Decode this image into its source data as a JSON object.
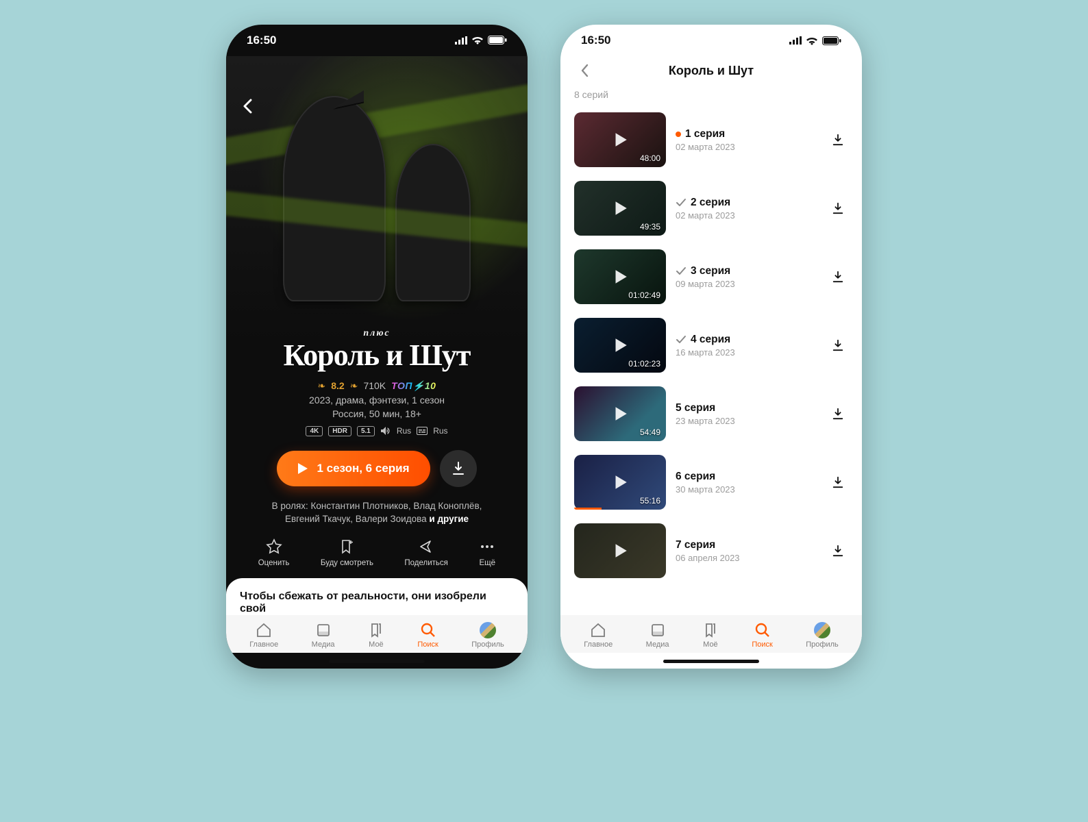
{
  "status": {
    "time": "16:50"
  },
  "dark": {
    "brand": "плюс",
    "title": "Король и Шут",
    "rating": "8.2",
    "rating_count": "710K",
    "top": "ТОП⚡10",
    "meta1": "2023, драма, фэнтези, 1 сезон",
    "meta2": "Россия, 50 мин, 18+",
    "tech": {
      "k4": "4K",
      "hdr": "HDR",
      "audio51": "5.1",
      "audio_lang": "Rus",
      "sub_lang": "Rus"
    },
    "play_label": "1 сезон, 6 серия",
    "cast_prefix": "В ролях: ",
    "cast": "Константин Плотников, Влад Коноплёв, Евгений Ткачук, Валери Зоидова",
    "cast_more": "и другие",
    "actions": {
      "rate": "Оценить",
      "watch": "Буду смотреть",
      "share": "Поделиться",
      "more": "Ещё"
    },
    "blurb": "Чтобы сбежать от реальности, они изобрели свой"
  },
  "light": {
    "title": "Король и Шут",
    "count": "8 серий",
    "episodes": [
      {
        "title": "1 серия",
        "date": "02 марта 2023",
        "dur": "48:00",
        "status": "current",
        "thumb": "t1",
        "progress": 0
      },
      {
        "title": "2 серия",
        "date": "02 марта 2023",
        "dur": "49:35",
        "status": "watched",
        "thumb": "t2",
        "progress": 0
      },
      {
        "title": "3 серия",
        "date": "09 марта 2023",
        "dur": "01:02:49",
        "status": "watched",
        "thumb": "t3",
        "progress": 0
      },
      {
        "title": "4 серия",
        "date": "16 марта 2023",
        "dur": "01:02:23",
        "status": "watched",
        "thumb": "t4",
        "progress": 0
      },
      {
        "title": "5 серия",
        "date": "23 марта 2023",
        "dur": "54:49",
        "status": "none",
        "thumb": "t5",
        "progress": 0
      },
      {
        "title": "6 серия",
        "date": "30 марта 2023",
        "dur": "55:16",
        "status": "none",
        "thumb": "t6",
        "progress": 30
      },
      {
        "title": "7 серия",
        "date": "06 апреля 2023",
        "dur": "",
        "status": "none",
        "thumb": "t7",
        "progress": 0
      }
    ]
  },
  "tabs": {
    "home": "Главное",
    "media": "Медиа",
    "mine": "Моё",
    "search": "Поиск",
    "profile": "Профиль"
  }
}
